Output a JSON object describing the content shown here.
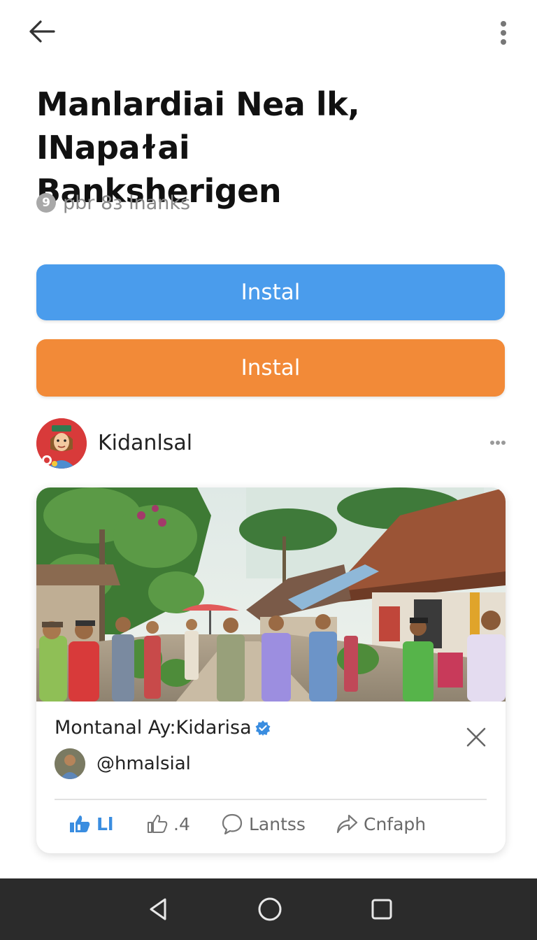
{
  "header": {
    "back_icon": "arrow-left-icon",
    "more_icon": "vertical-dots-icon"
  },
  "article": {
    "title_line1": "Manlardiai Nea lk, INapaɫai",
    "title_line2": "Banksherigen",
    "meta_icon_text": "9",
    "meta_text": "pbr 8ɜ lnanks"
  },
  "buttons": {
    "primary_label": "Instal",
    "secondary_label": "Instal",
    "primary_color": "#4a9cec",
    "secondary_color": "#f28a38"
  },
  "author": {
    "name": "Kidanlsal",
    "more_icon": "horizontal-dots-icon"
  },
  "post": {
    "title": "Montanal Ay:Kidarisa",
    "verified_icon": "verified-badge-icon",
    "handle": "@hmalsial",
    "close_icon": "close-icon",
    "actions": {
      "like_label": "Ll",
      "thumb_label": ".4",
      "comment_label": "Lantss",
      "share_label": "Cnfaph"
    }
  },
  "navbar": {
    "back_icon": "triangle-back-icon",
    "home_icon": "circle-home-icon",
    "recent_icon": "square-recents-icon"
  }
}
